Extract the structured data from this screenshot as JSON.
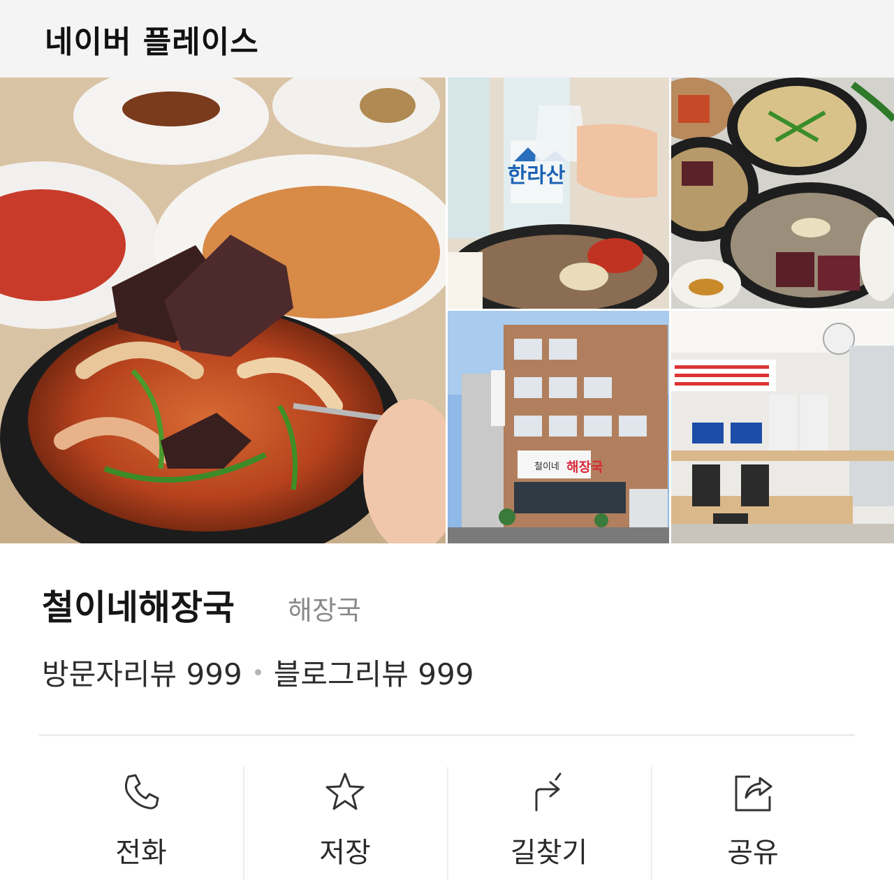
{
  "header": {
    "title": "네이버 플레이스"
  },
  "gallery": {
    "photos": [
      {
        "name": "main-dish-photo"
      },
      {
        "name": "soju-photo",
        "bottle_text": "한라산"
      },
      {
        "name": "table-spread-photo"
      },
      {
        "name": "storefront-photo",
        "sign_text": "해장국",
        "sign_small": "철이네"
      },
      {
        "name": "interior-photo"
      }
    ]
  },
  "place": {
    "name": "철이네해장국",
    "category": "해장국",
    "visitor_reviews": "방문자리뷰 999",
    "blog_reviews": "블로그리뷰 999"
  },
  "actions": [
    {
      "label": "전화",
      "icon": "phone-icon"
    },
    {
      "label": "저장",
      "icon": "star-icon"
    },
    {
      "label": "길찾기",
      "icon": "directions-icon"
    },
    {
      "label": "공유",
      "icon": "share-icon"
    }
  ],
  "colors": {
    "header_bg": "#f4f4f4",
    "divider": "#ececec",
    "category": "#8a8a8a",
    "sign_red": "#d8283a"
  }
}
